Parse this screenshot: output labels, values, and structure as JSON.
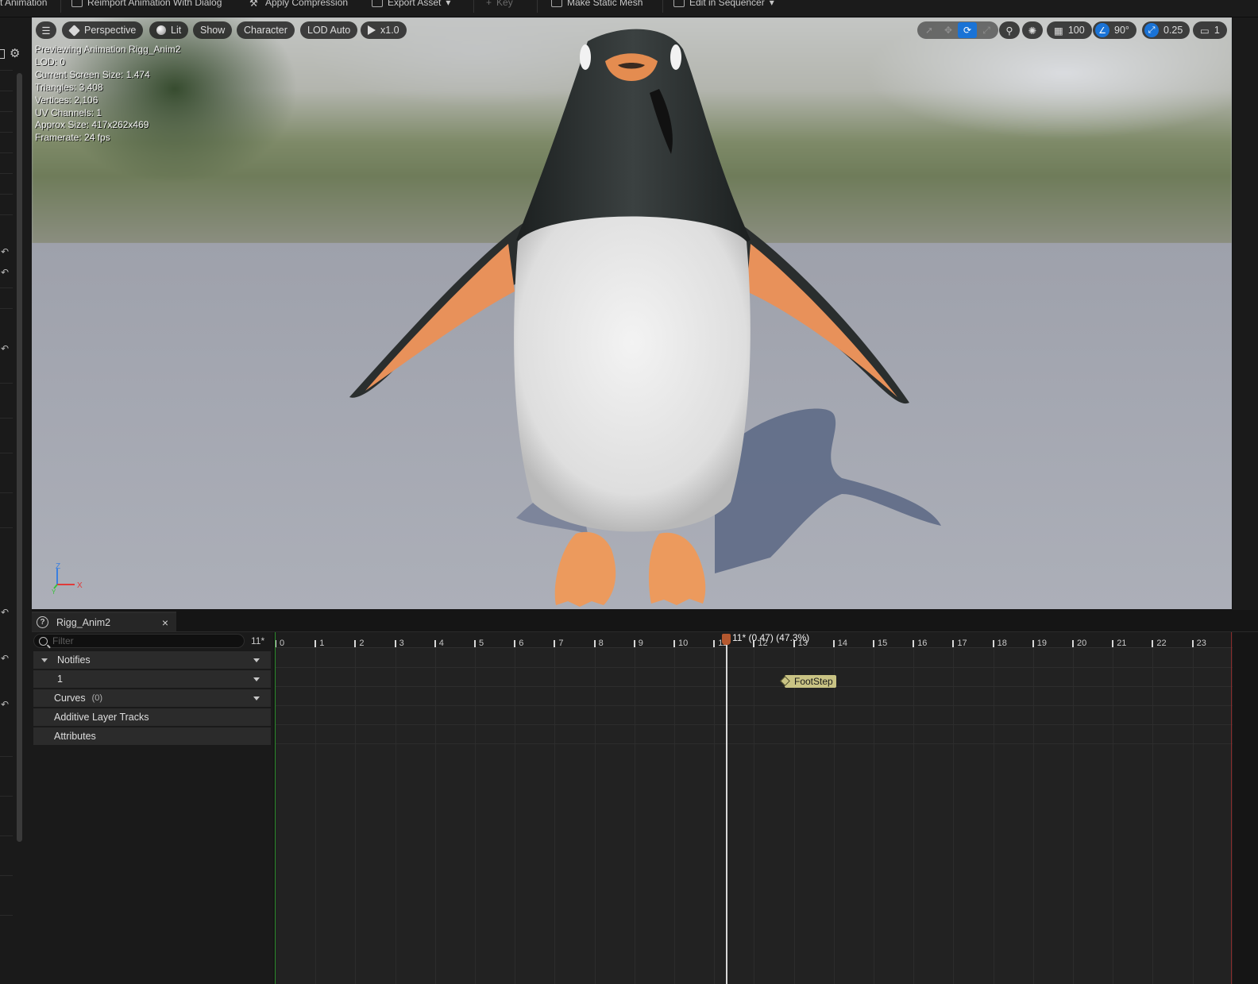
{
  "toolbar": {
    "items": [
      {
        "label": "t Animation",
        "enabled": true
      },
      {
        "label": "Reimport Animation With Dialog",
        "enabled": true
      },
      {
        "label": "Apply Compression",
        "enabled": true
      },
      {
        "label": "Export Asset",
        "enabled": true
      },
      {
        "label": "Key",
        "enabled": false
      },
      {
        "label": "Make Static Mesh",
        "enabled": true
      },
      {
        "label": "Edit in Sequencer",
        "enabled": true
      }
    ]
  },
  "viewport": {
    "perspective_label": "Perspective",
    "lit_label": "Lit",
    "show_label": "Show",
    "character_label": "Character",
    "lod_label": "LOD Auto",
    "speed_label": "x1.0",
    "grid_snap": "100",
    "rotation_snap": "90°",
    "scale_snap": "0.25",
    "camera_speed": "1",
    "stats": {
      "previewing": "Previewing Animation Rigg_Anim2",
      "lod": "LOD: 0",
      "screen_size": "Current Screen Size: 1.474",
      "triangles": "Triangles: 3,408",
      "vertices": "Vertices: 2,106",
      "uv_channels": "UV Channels: 1",
      "approx_size": "Approx Size: 417x262x469",
      "framerate": "Framerate: 24 fps"
    },
    "axis": {
      "z": "Z",
      "x": "X",
      "y": "Y"
    },
    "colors": {
      "accent": "#1a73d6",
      "scrub": "#b4582f",
      "notify": "#c9c384"
    }
  },
  "editor": {
    "tab_title": "Rigg_Anim2",
    "filter_placeholder": "Filter",
    "frame_readout": "11*",
    "tracks": {
      "notifies": "Notifies",
      "notify_track_1": "1",
      "curves": "Curves",
      "curves_count": "(0)",
      "additive": "Additive Layer Tracks",
      "attributes": "Attributes"
    },
    "ruler": [
      "0",
      "1",
      "2",
      "3",
      "4",
      "5",
      "6",
      "7",
      "8",
      "9",
      "10",
      "11",
      "12",
      "13",
      "14",
      "15",
      "16",
      "17",
      "18",
      "19",
      "20",
      "21",
      "22",
      "23"
    ],
    "scrub_label": "11* (0.47) (47.3%)",
    "notify_event": "FootStep"
  }
}
